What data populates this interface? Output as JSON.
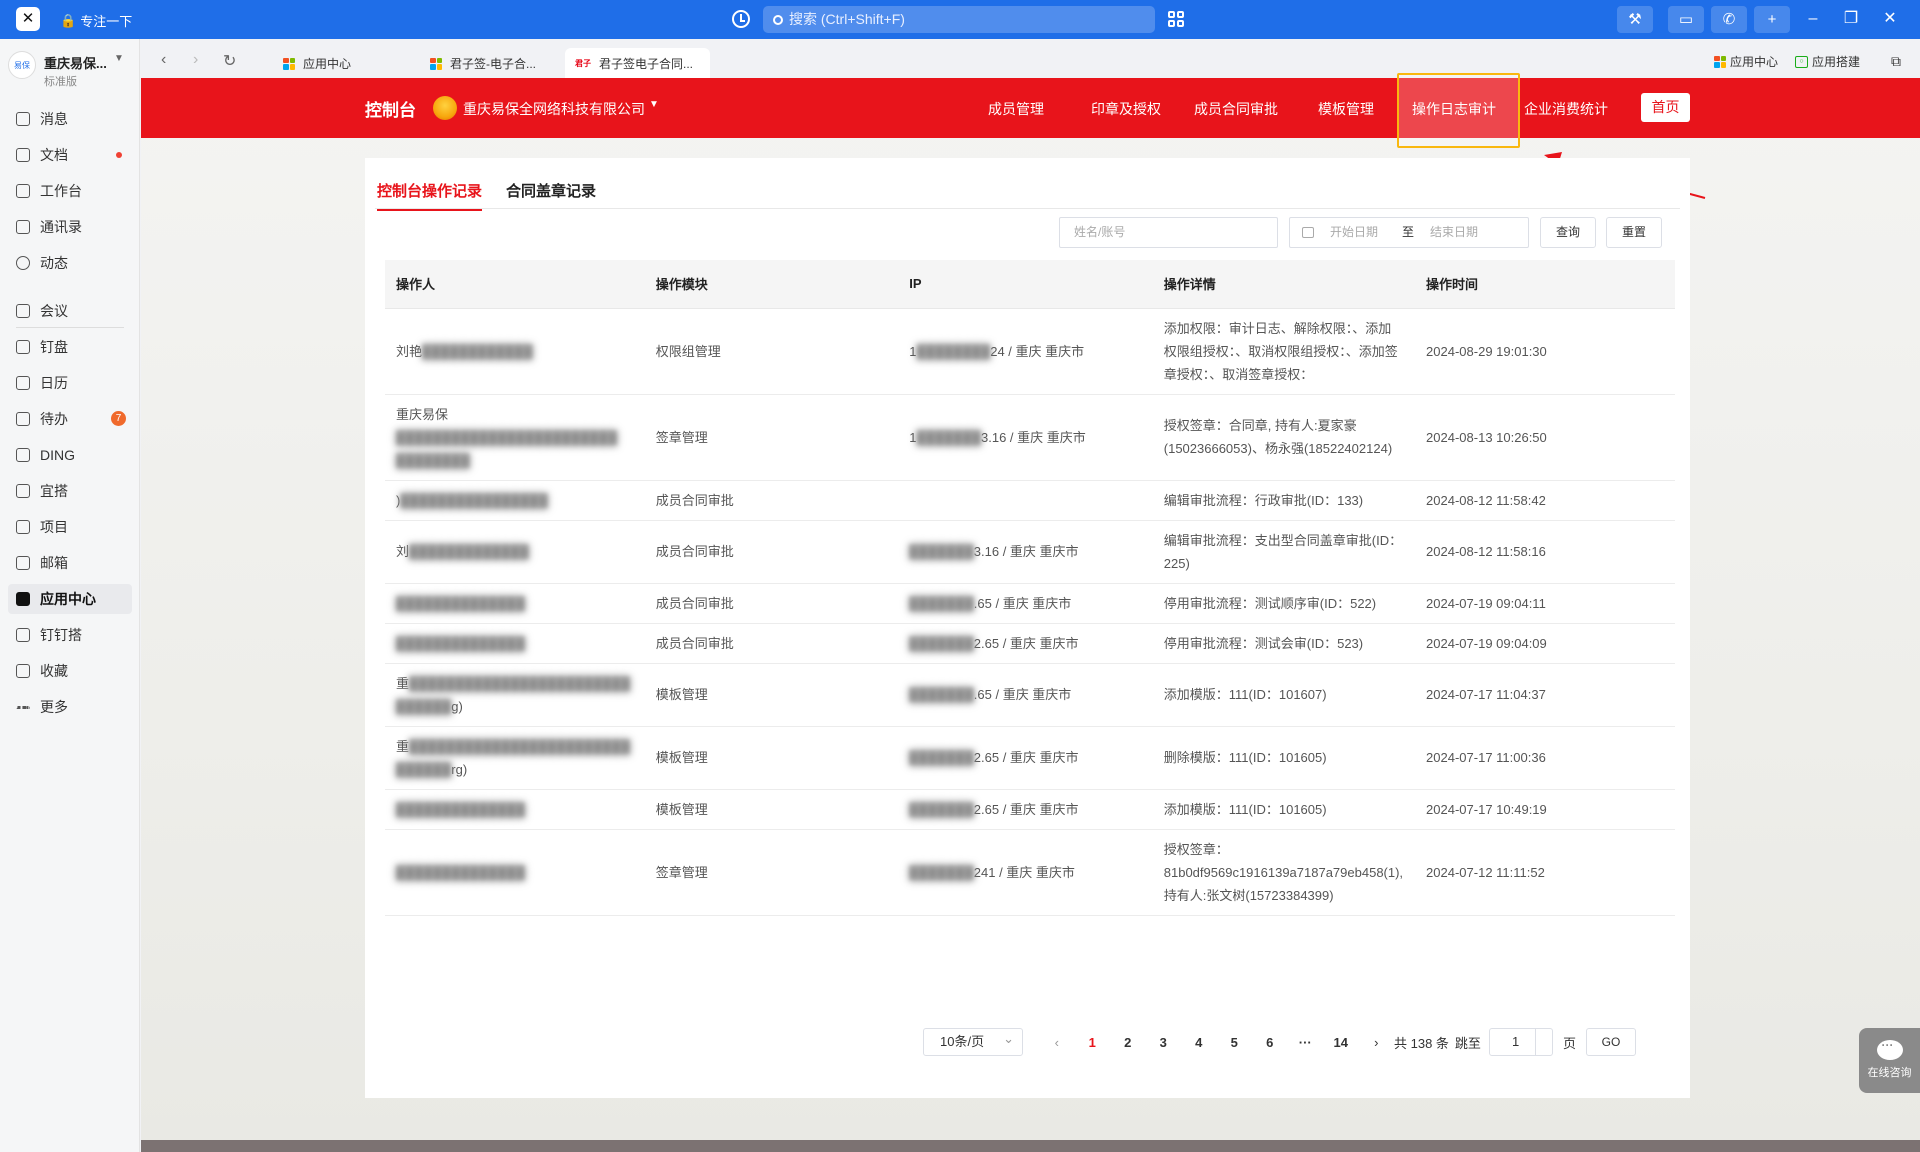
{
  "titlebar": {
    "focus_label": "专注一下",
    "search_placeholder": "搜索 (Ctrl+Shift+F)"
  },
  "sidebar": {
    "org_name": "重庆易保...",
    "org_plan": "标准版",
    "items": [
      {
        "label": "消息"
      },
      {
        "label": "文档"
      },
      {
        "label": "工作台"
      },
      {
        "label": "通讯录"
      },
      {
        "label": "动态"
      },
      {
        "label": "会议"
      },
      {
        "label": "钉盘"
      },
      {
        "label": "日历"
      },
      {
        "label": "待办",
        "badge": "7"
      },
      {
        "label": "DING"
      },
      {
        "label": "宜搭"
      },
      {
        "label": "项目"
      },
      {
        "label": "邮箱"
      },
      {
        "label": "应用中心"
      },
      {
        "label": "钉钉搭"
      },
      {
        "label": "收藏"
      },
      {
        "label": "更多"
      }
    ]
  },
  "tabs": [
    {
      "label": "应用中心"
    },
    {
      "label": "君子签-电子合..."
    },
    {
      "label": "君子签电子合同..."
    }
  ],
  "tabbar_right": {
    "app_center": "应用中心",
    "app_build": "应用搭建"
  },
  "header": {
    "title": "控制台",
    "company": "重庆易保全网络科技有限公司",
    "menu": [
      "成员管理",
      "印章及授权",
      "成员合同审批",
      "模板管理",
      "操作日志审计",
      "企业消费统计"
    ],
    "home": "首页"
  },
  "subtabs": [
    "控制台操作记录",
    "合同盖章记录"
  ],
  "filters": {
    "name_placeholder": "姓名/账号",
    "start_date": "开始日期",
    "range_sep": "至",
    "end_date": "结束日期",
    "query": "查询",
    "reset": "重置"
  },
  "table": {
    "headers": [
      "操作人",
      "操作模块",
      "IP",
      "操作详情",
      "操作时间"
    ],
    "rows": [
      {
        "op": "刘艳",
        "op_blur": "████████████",
        "module": "权限组管理",
        "ip_pre": "1",
        "ip_blur": "████████",
        "ip": "24 / 重庆 重庆市",
        "detail": "添加权限：审计日志、解除权限：、添加权限组授权：、取消权限组授权：、添加签章授权：、取消签章授权：",
        "time": "2024-08-29 19:01:30"
      },
      {
        "op": "重庆易保",
        "op_blur": "████████████████████████ ████████",
        "module": "签章管理",
        "ip_pre": "1",
        "ip_blur": "███████",
        "ip": "3.16 / 重庆 重庆市",
        "detail": "授权签章：合同章, 持有人:夏家豪(15023666053)、杨永强(18522402124)",
        "time": "2024-08-13 10:26:50"
      },
      {
        "op": ")",
        "op_blur": "████████████████",
        "module": "成员合同审批",
        "ip_pre": "",
        "ip_blur": "",
        "ip": "",
        "detail": "编辑审批流程：行政审批(ID：133)",
        "time": "2024-08-12 11:58:42"
      },
      {
        "op": "刘",
        "op_blur": "█████████████",
        "module": "成员合同审批",
        "ip_pre": "",
        "ip_blur": "███████",
        "ip": "3.16 / 重庆 重庆市",
        "detail": "编辑审批流程：支出型合同盖章审批(ID：225)",
        "time": "2024-08-12 11:58:16"
      },
      {
        "op": "",
        "op_blur": "██████████████",
        "module": "成员合同审批",
        "ip_pre": "",
        "ip_blur": "███████",
        "ip": ".65 / 重庆 重庆市",
        "detail": "停用审批流程：测试顺序审(ID：522)",
        "time": "2024-07-19 09:04:11"
      },
      {
        "op": "",
        "op_blur": "██████████████",
        "module": "成员合同审批",
        "ip_pre": "",
        "ip_blur": "███████",
        "ip": "2.65 / 重庆 重庆市",
        "detail": "停用审批流程：测试会审(ID：523)",
        "time": "2024-07-19 09:04:09"
      },
      {
        "op": "重",
        "op_blur": "████████████████████████ ██████",
        "op_tail": "g)",
        "module": "模板管理",
        "ip_pre": "",
        "ip_blur": "███████",
        "ip": ".65 / 重庆 重庆市",
        "detail": "添加模版：111(ID：101607)",
        "time": "2024-07-17 11:04:37"
      },
      {
        "op": "重",
        "op_blur": "████████████████████████ ██████",
        "op_tail": "rg)",
        "module": "模板管理",
        "ip_pre": "",
        "ip_blur": "███████",
        "ip": "2.65 / 重庆 重庆市",
        "detail": "删除模版：111(ID：101605)",
        "time": "2024-07-17 11:00:36"
      },
      {
        "op": "",
        "op_blur": "██████████████",
        "module": "模板管理",
        "ip_pre": "",
        "ip_blur": "███████",
        "ip": "2.65 / 重庆 重庆市",
        "detail": "添加模版：111(ID：101605)",
        "time": "2024-07-17 10:49:19"
      },
      {
        "op": "",
        "op_blur": "██████████████",
        "module": "签章管理",
        "ip_pre": "",
        "ip_blur": "███████",
        "ip": "241 / 重庆 重庆市",
        "detail": "授权签章：81b0df9569c1916139a7187a79eb458(1), 持有人:张文树(15723384399)",
        "time": "2024-07-12 11:11:52"
      }
    ]
  },
  "pagination": {
    "page_size": "10条/页",
    "pages": [
      "1",
      "2",
      "3",
      "4",
      "5",
      "6",
      "···",
      "14"
    ],
    "total": "共 138 条",
    "jump_label": "跳至",
    "jump_value": "1",
    "page_unit": "页",
    "go": "GO"
  },
  "consult": "在线咨询"
}
